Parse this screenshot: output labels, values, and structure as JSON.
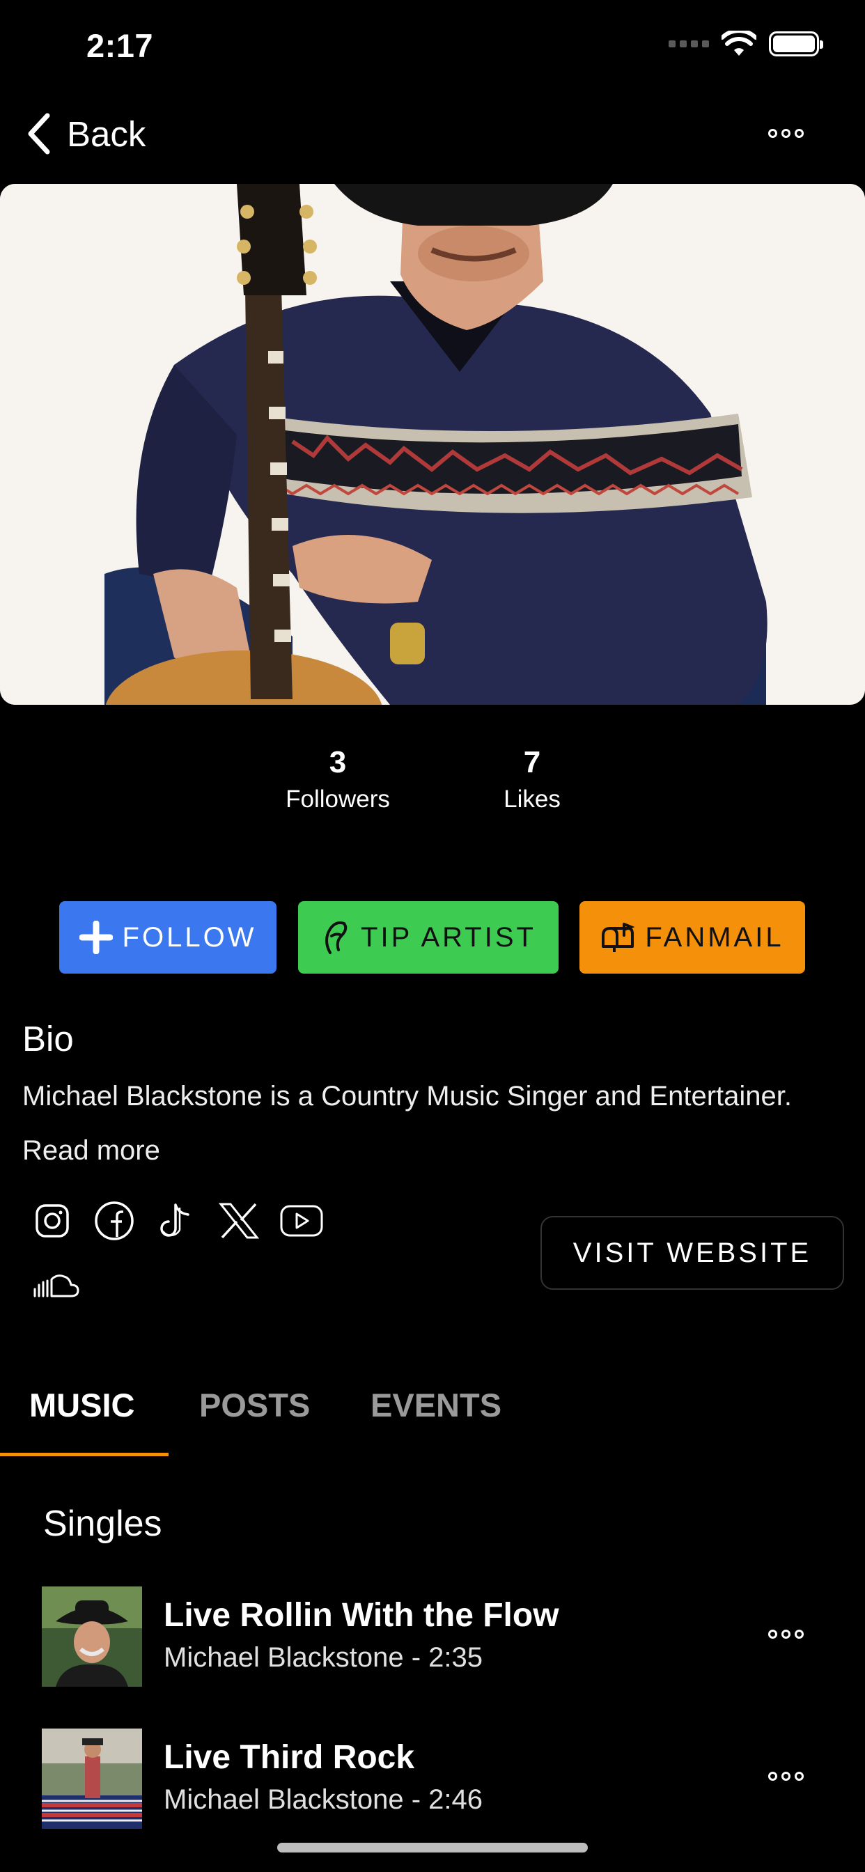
{
  "status_bar": {
    "time": "2:17"
  },
  "nav": {
    "back_label": "Back"
  },
  "stats": {
    "followers": {
      "value": "3",
      "label": "Followers"
    },
    "likes": {
      "value": "7",
      "label": "Likes"
    }
  },
  "actions": {
    "follow_label": "FOLLOW",
    "tip_label": "TIP ARTIST",
    "fanmail_label": "FANMAIL"
  },
  "bio": {
    "heading": "Bio",
    "text": "Michael Blackstone is a Country Music Singer and Entertainer.",
    "read_more": "Read more"
  },
  "social_icons": [
    "instagram-icon",
    "facebook-icon",
    "tiktok-icon",
    "x-icon",
    "youtube-icon",
    "soundcloud-icon"
  ],
  "visit_website_label": "VISIT WEBSITE",
  "tabs": [
    {
      "label": "MUSIC",
      "active": true
    },
    {
      "label": "POSTS",
      "active": false
    },
    {
      "label": "EVENTS",
      "active": false
    }
  ],
  "section": {
    "title": "Singles"
  },
  "tracks": [
    {
      "title": "Live Rollin With the Flow",
      "meta": "Michael Blackstone - 2:35"
    },
    {
      "title": "Live Third Rock",
      "meta": "Michael Blackstone - 2:46"
    }
  ],
  "colors": {
    "accent": "#f5900a",
    "follow": "#3b78ef",
    "tip": "#3ecb52",
    "fanmail": "#f5900a",
    "background": "#000000"
  }
}
